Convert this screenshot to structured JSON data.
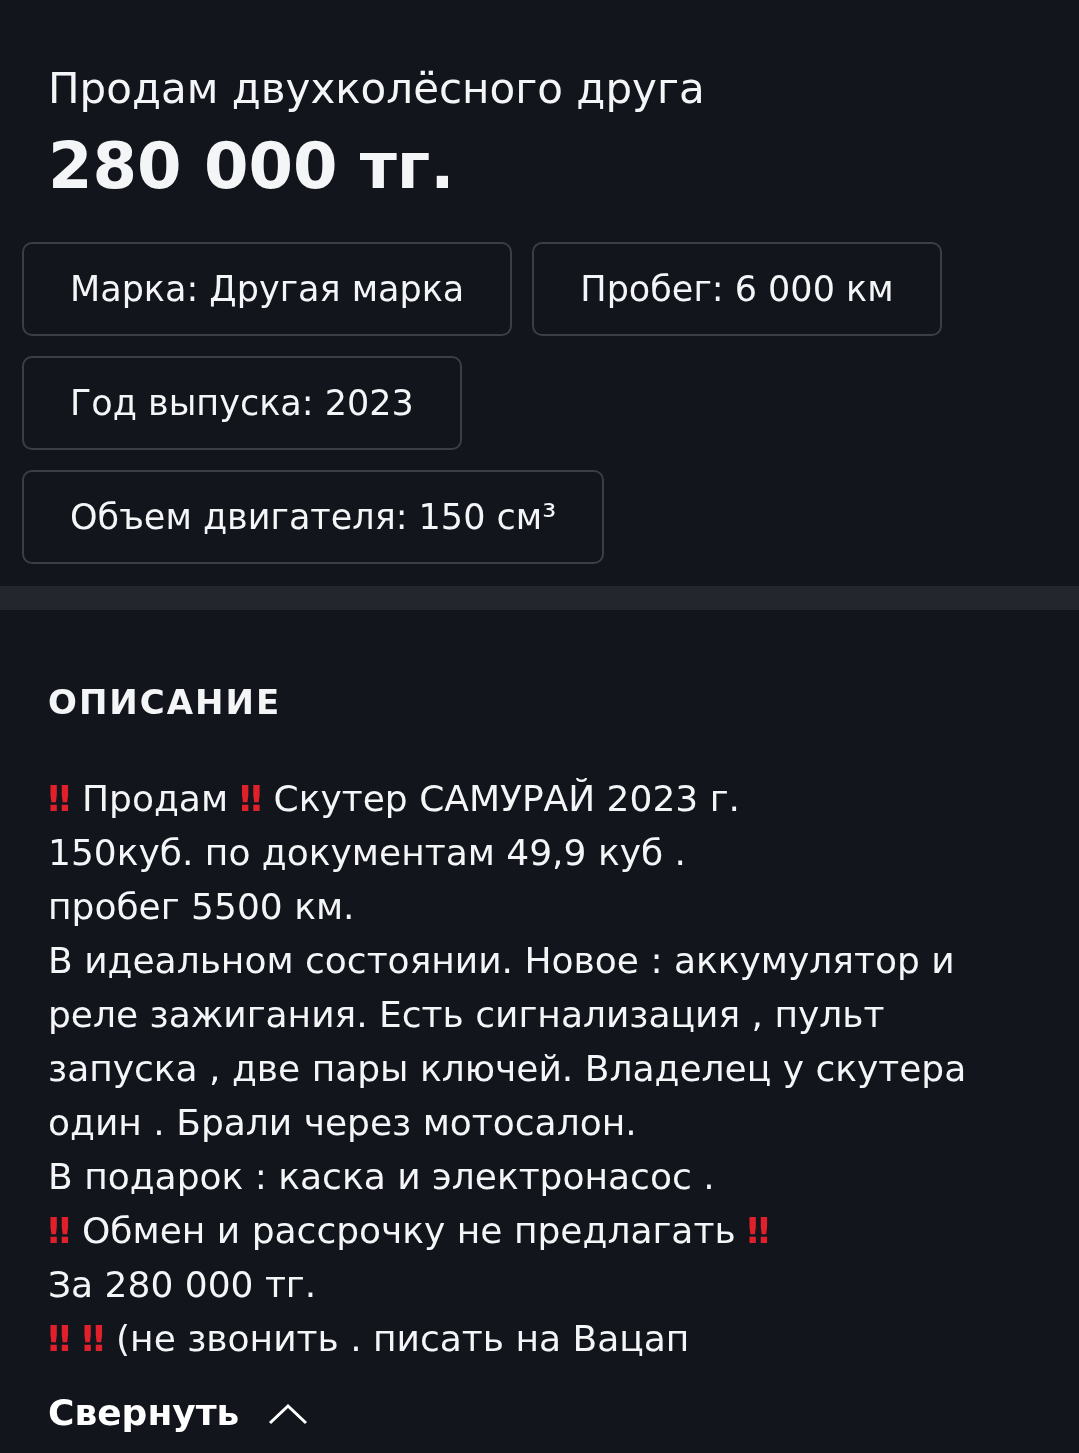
{
  "listing": {
    "title": "Продам двухколёсного друга",
    "price": "280 000 тг."
  },
  "specs": [
    {
      "text": "Марка: Другая марка"
    },
    {
      "text": "Пробег: 6 000 км"
    },
    {
      "text": "Год выпуска: 2023"
    },
    {
      "text": "Объем двигателя: 150 см³"
    }
  ],
  "description": {
    "heading": "ОПИСАНИЕ",
    "lines": [
      "‼ Продам ‼ Скутер САМУРАЙ 2023 г.",
      "150куб. по документам 49,9 куб .",
      "пробег 5500 км.",
      "В идеальном состоянии. Новое : аккумулятор и",
      "реле зажигания. Есть сигнализация , пульт",
      "запуска , две пары ключей. Владелец у скутера",
      "один . Брали через мотосалон.",
      "В подарок : каска и электронасос .",
      "‼ Обмен и рассрочку не предлагать ‼",
      "За 280 000 тг.",
      "‼ ‼ (не звонить . писать на Вацап"
    ],
    "collapse": "Свернуть"
  }
}
